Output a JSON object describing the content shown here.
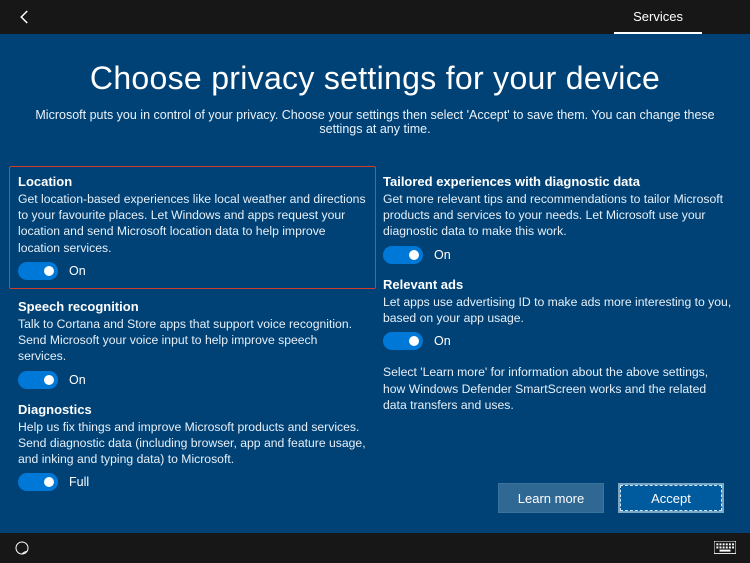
{
  "header": {
    "tab": "Services"
  },
  "page": {
    "title": "Choose privacy settings for your device",
    "subtitle": "Microsoft puts you in control of your privacy. Choose your settings then select 'Accept' to save them. You can change these settings at any time."
  },
  "settings": {
    "location": {
      "title": "Location",
      "desc": "Get location-based experiences like local weather and directions to your favourite places. Let Windows and apps request your location and send Microsoft location data to help improve location services.",
      "state": "On"
    },
    "speech": {
      "title": "Speech recognition",
      "desc": "Talk to Cortana and Store apps that support voice recognition. Send Microsoft your voice input to help improve speech services.",
      "state": "On"
    },
    "diagnostics": {
      "title": "Diagnostics",
      "desc": "Help us fix things and improve Microsoft products and services. Send diagnostic data (including browser, app and feature usage, and inking and typing data) to Microsoft.",
      "state": "Full"
    },
    "tailored": {
      "title": "Tailored experiences with diagnostic data",
      "desc": "Get more relevant tips and recommendations to tailor Microsoft products and services to your needs. Let Microsoft use your diagnostic data to make this work.",
      "state": "On"
    },
    "ads": {
      "title": "Relevant ads",
      "desc": "Let apps use advertising ID to make ads more interesting to you, based on your app usage.",
      "state": "On"
    }
  },
  "info_text": "Select 'Learn more' for information about the above settings, how Windows Defender SmartScreen works and the related data transfers and uses.",
  "buttons": {
    "learn_more": "Learn more",
    "accept": "Accept"
  }
}
